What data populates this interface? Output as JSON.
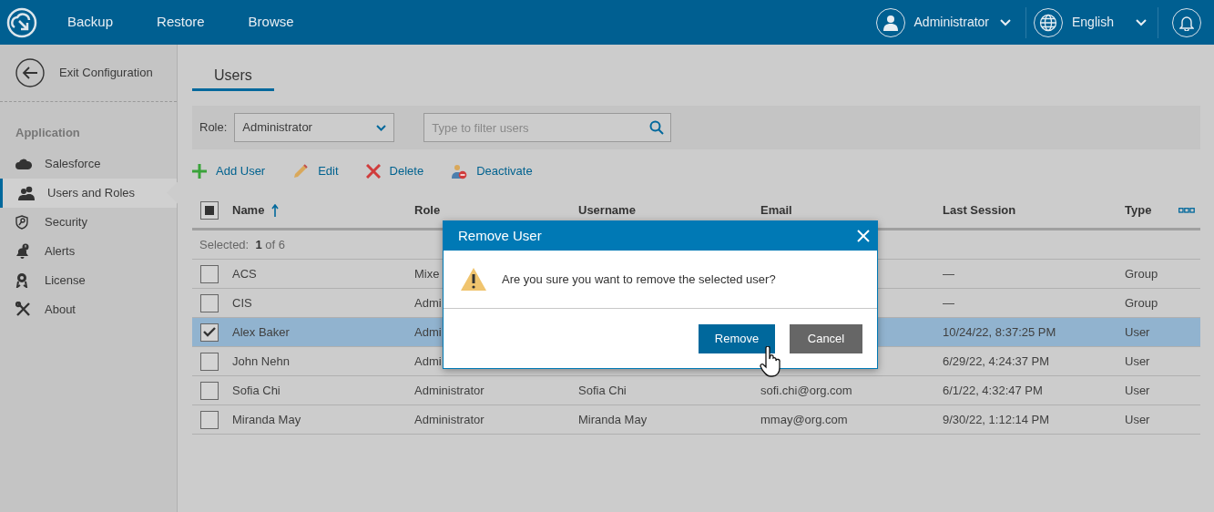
{
  "app_bar": {
    "nav": [
      {
        "label": "Backup"
      },
      {
        "label": "Restore"
      },
      {
        "label": "Browse"
      }
    ],
    "user": "Administrator",
    "language": "English"
  },
  "sidebar": {
    "exit": "Exit Configuration",
    "section": "Application",
    "items": [
      {
        "label": "Salesforce",
        "selected": false
      },
      {
        "label": "Users and Roles",
        "selected": true
      },
      {
        "label": "Security",
        "selected": false
      },
      {
        "label": "Alerts",
        "selected": false
      },
      {
        "label": "License",
        "selected": false
      },
      {
        "label": "About",
        "selected": false
      }
    ]
  },
  "tabs": [
    {
      "label": "Users",
      "selected": true
    }
  ],
  "filter": {
    "role_label": "Role:",
    "role_value": "Administrator",
    "search_placeholder": "Type to filter users"
  },
  "actions": [
    "Add User",
    "Edit",
    "Delete",
    "Deactivate"
  ],
  "table": {
    "select_all_partial": true,
    "columns": [
      {
        "label": "Name",
        "sorted": true
      },
      {
        "label": "Role",
        "sorted": false
      },
      {
        "label": "Username",
        "sorted": false
      },
      {
        "label": "Email",
        "sorted": false
      },
      {
        "label": "Last Session",
        "sorted": false
      },
      {
        "label": "Type",
        "sorted": false
      }
    ],
    "selection": "Selected:  **1** of 6",
    "rows": [
      {
        "name": "ACS",
        "role": "Mixe",
        "last_session": "—",
        "type": "Group",
        "checked": false,
        "selected": false
      },
      {
        "name": "CIS",
        "role": "Admi",
        "last_session": "—",
        "type": "Group",
        "checked": false,
        "selected": false
      },
      {
        "name": "Alex Baker",
        "role": "Admi",
        "last_session": "10/24/22, 8:37:25 PM",
        "type": "User",
        "checked": true,
        "selected": true
      },
      {
        "name": "John Nehn",
        "role": "Admi",
        "last_session": "6/29/22, 4:24:37 PM",
        "type": "User",
        "checked": false,
        "selected": false
      },
      {
        "name": "Sofia Chi",
        "role": "Administrator",
        "username": "Sofia Chi",
        "email": "sofi.chi@org.com",
        "last_session": "6/1/22, 4:32:47 PM",
        "type": "User",
        "checked": false,
        "selected": false
      },
      {
        "name": "Miranda May",
        "role": "Administrator",
        "username": "Miranda May",
        "email": "mmay@org.com",
        "last_session": "9/30/22, 1:12:14 PM",
        "type": "User",
        "checked": false,
        "selected": false
      }
    ]
  },
  "dialog": {
    "title": "Remove User",
    "message": "Are you sure you want to remove the selected user?",
    "buttons": [
      {
        "label": "Remove",
        "kind": "primary"
      },
      {
        "label": "Cancel",
        "kind": "secondary"
      }
    ]
  }
}
